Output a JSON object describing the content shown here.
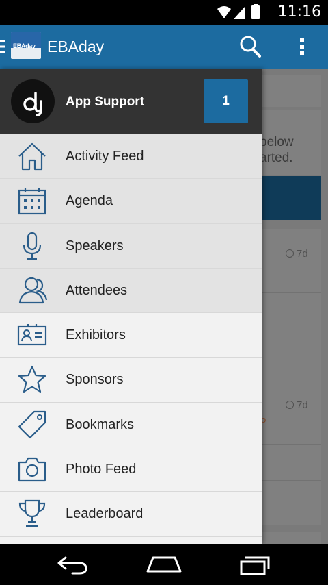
{
  "status_bar": {
    "time": "11:16",
    "icons": [
      "wifi-icon",
      "signal-icon",
      "battery-icon"
    ]
  },
  "app_bar": {
    "logo_text": "EBAday",
    "title": "EBAday",
    "icons": [
      "menu-icon",
      "search-icon",
      "overflow-menu-icon"
    ]
  },
  "drawer": {
    "header_label": "App Support",
    "badge_count": "1",
    "items": [
      {
        "label": "Activity Feed",
        "icon": "home-icon"
      },
      {
        "label": "Agenda",
        "icon": "calendar-icon"
      },
      {
        "label": "Speakers",
        "icon": "microphone-icon"
      },
      {
        "label": "Attendees",
        "icon": "people-icon"
      },
      {
        "label": "Exhibitors",
        "icon": "id-card-icon"
      },
      {
        "label": "Sponsors",
        "icon": "star-icon"
      },
      {
        "label": "Bookmarks",
        "icon": "tag-icon"
      },
      {
        "label": "Photo Feed",
        "icon": "camera-icon"
      },
      {
        "label": "Leaderboard",
        "icon": "trophy-icon"
      }
    ]
  },
  "background": {
    "text_line_1": "below",
    "text_line_2": "arted.",
    "age_1": "7d",
    "age_2": "7d"
  },
  "colors": {
    "brand": "#1c6ba0",
    "drawer_header": "#333333",
    "icon_stroke": "#2a5d8a"
  }
}
